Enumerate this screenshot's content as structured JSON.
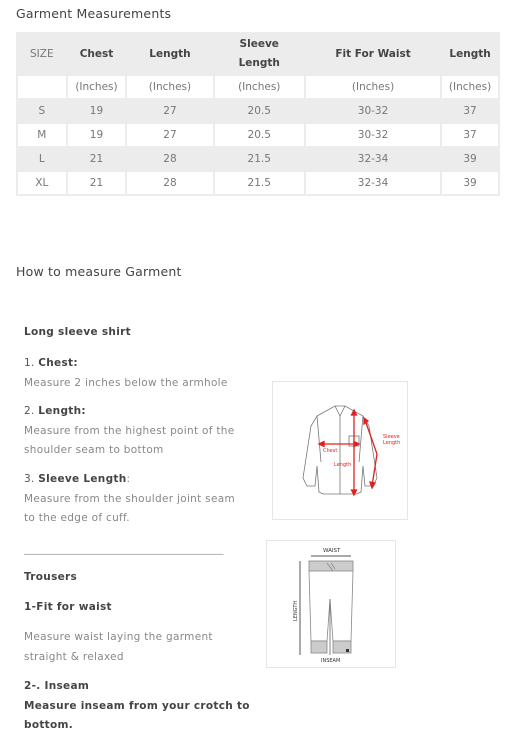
{
  "title": "Garment Measurements",
  "table": {
    "headers": [
      "SIZE",
      "Chest",
      "Length",
      "Sleeve Length",
      "Fit For Waist",
      "Length"
    ],
    "units": [
      "",
      "(Inches)",
      "(Inches)",
      "(Inches)",
      "(Inches)",
      "(Inches)"
    ],
    "rows": [
      [
        "S",
        "19",
        "27",
        "20.5",
        "30-32",
        "37"
      ],
      [
        "M",
        "19",
        "27",
        "20.5",
        "30-32",
        "37"
      ],
      [
        "L",
        "21",
        "28",
        "21.5",
        "32-34",
        "39"
      ],
      [
        "XL",
        "21",
        "28",
        "21.5",
        "32-34",
        "39"
      ]
    ]
  },
  "how_to": {
    "title": "How to measure Garment",
    "shirt": {
      "heading": "Long sleeve shirt",
      "items": [
        {
          "num": "1.",
          "label": "Chest:",
          "suffix": "",
          "desc": [
            "Measure 2 inches below the armhole"
          ]
        },
        {
          "num": "2.",
          "label": "Length:",
          "suffix": "",
          "desc": [
            "Measure from the highest point of the",
            "shoulder seam to bottom"
          ]
        },
        {
          "num": "3.",
          "label": "Sleeve Length",
          "suffix": ":",
          "desc": [
            "Measure from the shoulder joint seam",
            "to the edge of cuff."
          ]
        }
      ],
      "diagram_labels": {
        "chest": "Chest",
        "length": "Length",
        "sleeve1": "Sleeve",
        "sleeve2": "Length"
      }
    },
    "divider": "______________________________________",
    "trousers": {
      "heading": "Trousers",
      "item1_label": "1-Fit for waist",
      "item1_desc": [
        "Measure waist laying the garment",
        "straight & relaxed"
      ],
      "item2_label": "2-. Inseam",
      "item2_desc": [
        "Measure inseam from your crotch to",
        "bottom."
      ],
      "diagram_labels": {
        "waist": "WAIST",
        "length": "LENGTH",
        "inseam": "INSEAM"
      }
    }
  },
  "colors": {
    "accent": "#e02020",
    "table_bg": "#ececec"
  }
}
